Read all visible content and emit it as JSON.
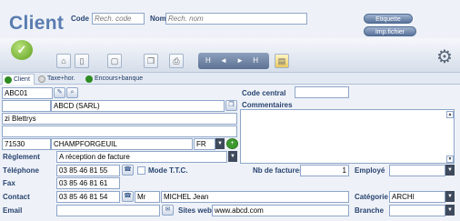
{
  "header": {
    "title": "Client",
    "code_label": "Code",
    "code_placeholder": "Rech. code",
    "nom_label": "Nom",
    "nom_placeholder": "Rech. nom",
    "btn_etiquette": "Etiquette",
    "btn_imp_fichier": "Imp.fichier"
  },
  "toolbar": {
    "nav_symbols": "H ◄ ► H"
  },
  "tabs": [
    {
      "label": "Client",
      "dot_color": "#2e8b22"
    },
    {
      "label": "Taxe+hor.",
      "dot_color": "#d9d9d9"
    },
    {
      "label": "Encours+banque",
      "dot_color": "#2e8b22"
    }
  ],
  "form": {
    "code": "ABC01",
    "company": "ABCD (SARL)",
    "address1": "zi Blettrys",
    "address2": "",
    "postal_code": "71530",
    "city": "CHAMPFORGEUIL",
    "country": "FR",
    "reglement_label": "Règlement",
    "reglement_value": "A réception de facture",
    "telephone_label": "Téléphone",
    "telephone_value": "03 85 46 81 55",
    "mode_ttc_label": "Mode T.T.C.",
    "fax_label": "Fax",
    "fax_value": "03 85 46 81 61",
    "contact_label": "Contact",
    "contact_phone": "03 85 46 81 54",
    "contact_civility": "Mr",
    "contact_name": "MICHEL Jean",
    "email_label": "Email",
    "email_value": "",
    "code_central_label": "Code central",
    "code_central_value": "",
    "commentaires_label": "Commentaires",
    "nb_factures_label": "Nb de factures",
    "nb_factures_value": "1",
    "employe_label": "Employé",
    "employe_value": "",
    "categorie_label": "Catégorie",
    "categorie_value": "ARCHI",
    "sites_web_label": "Sites web",
    "sites_web_value": "www.abcd.com",
    "branche_label": "Branche",
    "branche_value": ""
  }
}
